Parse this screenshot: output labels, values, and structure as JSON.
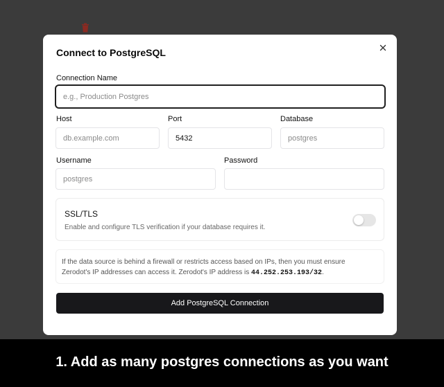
{
  "dialog": {
    "title": "Connect to PostgreSQL",
    "close_icon": "close-icon",
    "connection_name": {
      "label": "Connection Name",
      "value": "",
      "placeholder": "e.g., Production Postgres"
    },
    "host": {
      "label": "Host",
      "value": "",
      "placeholder": "db.example.com"
    },
    "port": {
      "label": "Port",
      "value": "5432",
      "placeholder": ""
    },
    "database": {
      "label": "Database",
      "value": "",
      "placeholder": "postgres"
    },
    "username": {
      "label": "Username",
      "value": "",
      "placeholder": "postgres"
    },
    "password": {
      "label": "Password",
      "value": "",
      "placeholder": ""
    },
    "ssl": {
      "title": "SSL/TLS",
      "description": "Enable and configure TLS verification if your database requires it.",
      "enabled": false
    },
    "info": {
      "text_before": "If the data source is behind a firewall or restricts access based on IPs, then you must ensure Zerodot's IP addresses can access it. Zerodot's IP address is ",
      "ip": "44.252.253.193/32",
      "text_after": "."
    },
    "submit_label": "Add PostgreSQL Connection"
  },
  "background": {
    "trash_icon": "trash-icon"
  },
  "caption": "1. Add as many postgres connections as you want",
  "colors": {
    "overlay": "#3b3b3b",
    "primary_button": "#18181b",
    "caption_bg": "#000000",
    "trash_icon": "#c0392b"
  }
}
